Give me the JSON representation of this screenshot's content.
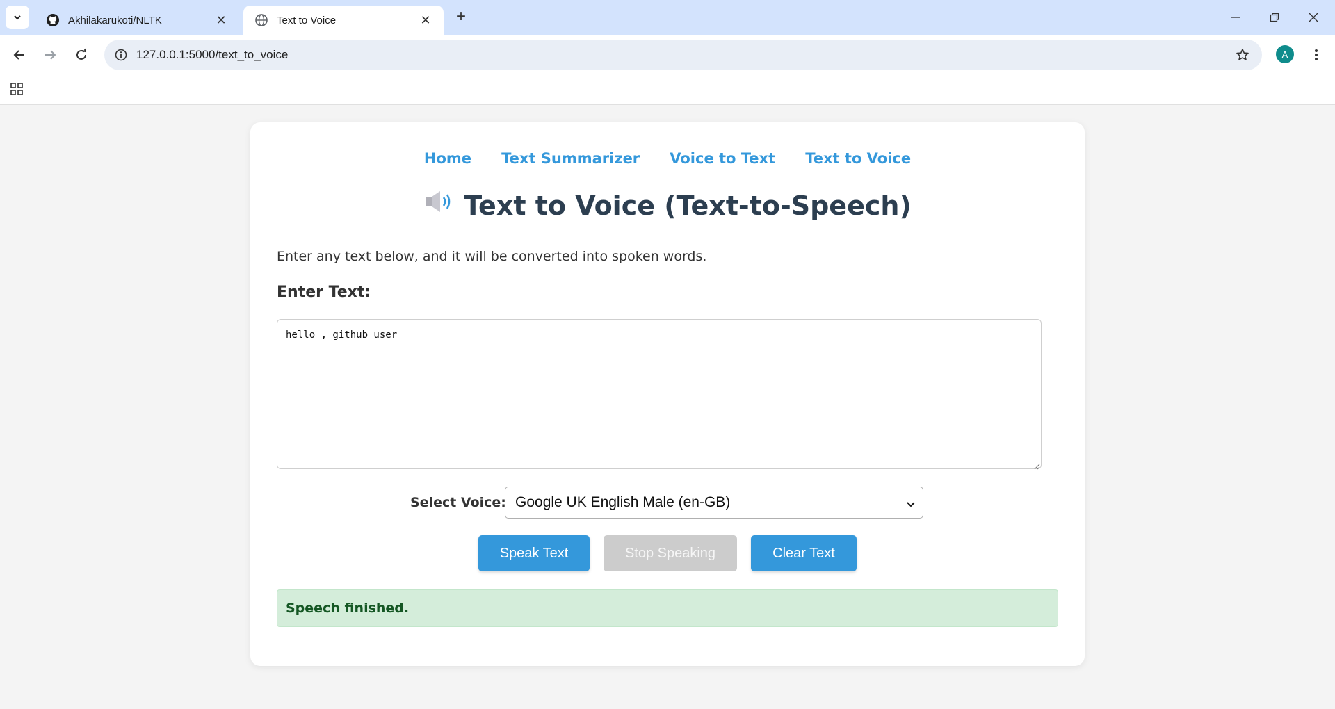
{
  "browser": {
    "tabs": [
      {
        "title": "Akhilakarukoti/NLTK",
        "icon": "github-icon",
        "active": false
      },
      {
        "title": "Text to Voice",
        "icon": "globe-icon",
        "active": true
      }
    ],
    "url": "127.0.0.1:5000/text_to_voice",
    "profile_initial": "A",
    "colors": {
      "tabbar": "#d3e3fd",
      "omnibox": "#e9eef6",
      "avatar": "#0f8c8c"
    }
  },
  "page": {
    "nav": [
      {
        "label": "Home"
      },
      {
        "label": "Text Summarizer"
      },
      {
        "label": "Voice to Text"
      },
      {
        "label": "Text to Voice"
      }
    ],
    "title": "Text to Voice (Text-to-Speech)",
    "title_icon": "speaker-icon",
    "description": "Enter any text below, and it will be converted into spoken words.",
    "input_label": "Enter Text:",
    "input_value": "hello , github user",
    "voice_label": "Select Voice:",
    "voice_selected": "Google UK English Male (en-GB)",
    "buttons": {
      "speak": "Speak Text",
      "stop": "Stop Speaking",
      "clear": "Clear Text"
    },
    "status": "Speech finished.",
    "colors": {
      "accent": "#3498db",
      "heading": "#2c3e50",
      "disabled": "#cccccc",
      "status_bg": "#d4edda",
      "status_text": "#155724"
    }
  }
}
